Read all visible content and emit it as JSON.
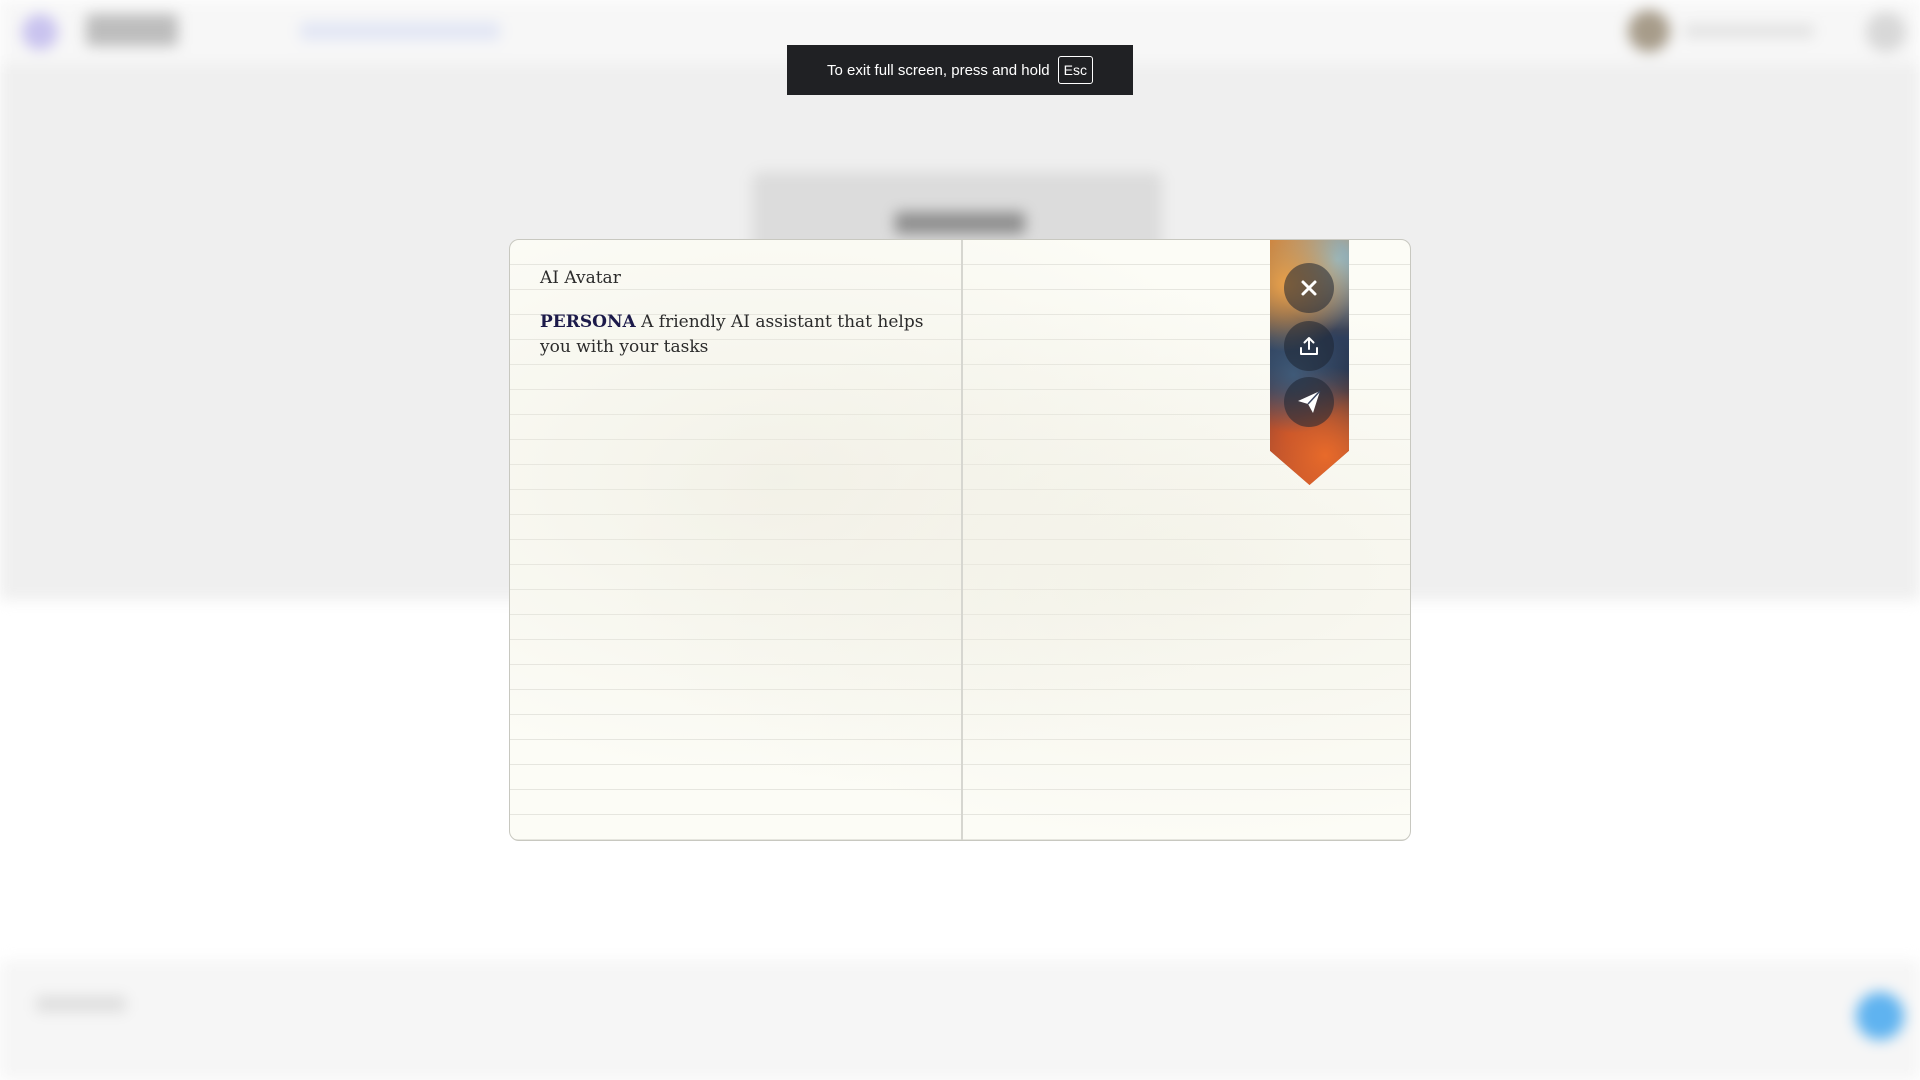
{
  "fullscreen_notice": {
    "message": "To exit full screen, press and hold",
    "key": "Esc"
  },
  "notebook": {
    "avatar_name": "AI Avatar",
    "persona_label": "PERSONA",
    "persona_text": " A friendly AI assistant that helps you with your tasks"
  },
  "ribbon_actions": {
    "icons": [
      "close-icon",
      "share-upload-icon",
      "send-paper-plane-icon"
    ]
  },
  "colors": {
    "toast_background": "#202124",
    "paper": "#fcfcf6",
    "persona_label": "#1c1a4a"
  }
}
